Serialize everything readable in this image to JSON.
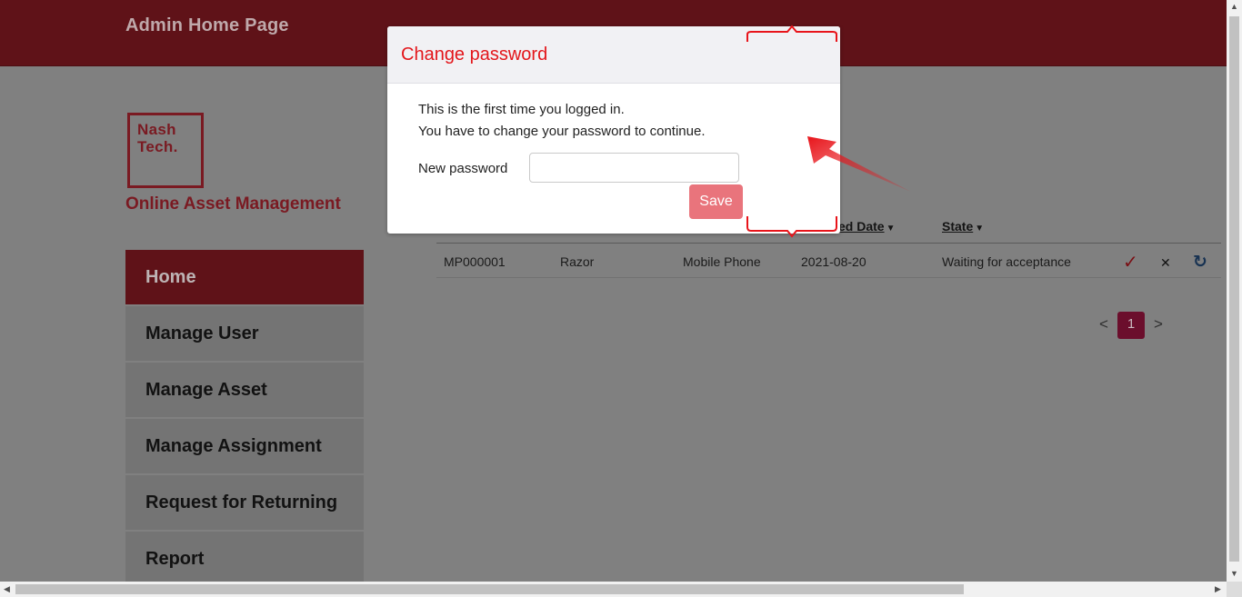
{
  "header": {
    "title": "Admin Home Page"
  },
  "brand": {
    "logo_line1": "Nash",
    "logo_line2": "Tech.",
    "app_title": "Online Asset Management"
  },
  "sidebar": {
    "items": [
      {
        "label": "Home",
        "active": true
      },
      {
        "label": "Manage User"
      },
      {
        "label": "Manage Asset"
      },
      {
        "label": "Manage Assignment"
      },
      {
        "label": "Request for Returning"
      },
      {
        "label": "Report"
      }
    ]
  },
  "table": {
    "columns": {
      "assigned_date": "ed Date",
      "state": "State"
    },
    "rows": [
      {
        "asset_code": "MP000001",
        "asset_name": "Razor",
        "category": "Mobile Phone",
        "assigned_date": "2021-08-20",
        "state": "Waiting for acceptance"
      }
    ],
    "actions": {
      "accept": "✓",
      "decline": "✕",
      "refresh": "↻"
    }
  },
  "pagination": {
    "prev": "<",
    "current": "1",
    "next": ">"
  },
  "modal": {
    "title": "Change password",
    "message_line1": "This is the first time you logged in.",
    "message_line2": "You have to change your password to continue.",
    "new_password_label": "New password",
    "new_password_value": "",
    "save_label": "Save"
  },
  "colors": {
    "brand": "#cf2338",
    "modal_title": "#e3161b",
    "save_button": "#e9747c",
    "annotation": "#e8141a"
  },
  "icons": {
    "accept": "check-icon",
    "decline": "close-icon",
    "refresh": "refresh-icon",
    "sort": "caret-down-icon"
  }
}
